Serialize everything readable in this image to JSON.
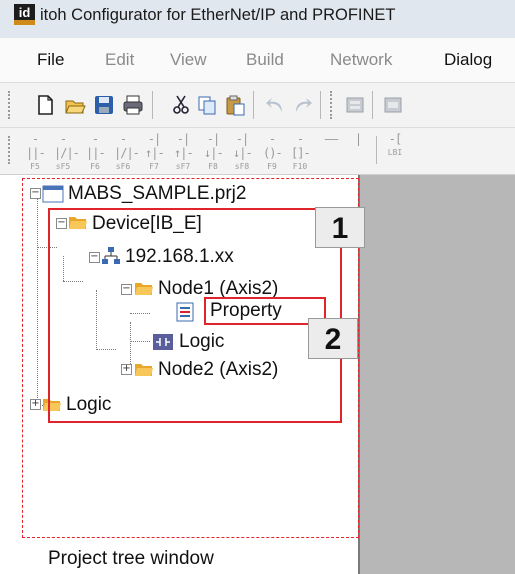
{
  "window": {
    "title": "itoh Configurator for EtherNet/IP and PROFINET",
    "app_icon_text": "id"
  },
  "menu": {
    "items": [
      {
        "label": "File",
        "active": true
      },
      {
        "label": "Edit",
        "active": false
      },
      {
        "label": "View",
        "active": false
      },
      {
        "label": "Build",
        "active": false
      },
      {
        "label": "Network",
        "active": false
      },
      {
        "label": "Dialog",
        "active": true
      }
    ]
  },
  "toolbar": {
    "icons": [
      "new-file-icon",
      "open-folder-icon",
      "save-icon",
      "print-icon",
      "cut-icon",
      "copy-icon",
      "paste-icon",
      "undo-icon",
      "redo-icon",
      "build-icon",
      "download-icon"
    ],
    "ladder_keys": [
      "F5",
      "sF5",
      "F6",
      "sF6",
      "F7",
      "sF7",
      "F8",
      "sF8",
      "F9",
      "F10"
    ],
    "partial_key": "LBI"
  },
  "tree": {
    "root": "MABS_SAMPLE.prj2",
    "device": "Device[IB_E]",
    "ip": "192.168.1.xx",
    "node1": "Node1 (Axis2)",
    "property": "Property",
    "logic_child": "Logic",
    "node2": "Node2 (Axis2)",
    "logic_root": "Logic"
  },
  "annotations": {
    "callout1": "1",
    "callout2": "2",
    "caption": "Project tree window",
    "highlight_color": "#e0242b"
  }
}
